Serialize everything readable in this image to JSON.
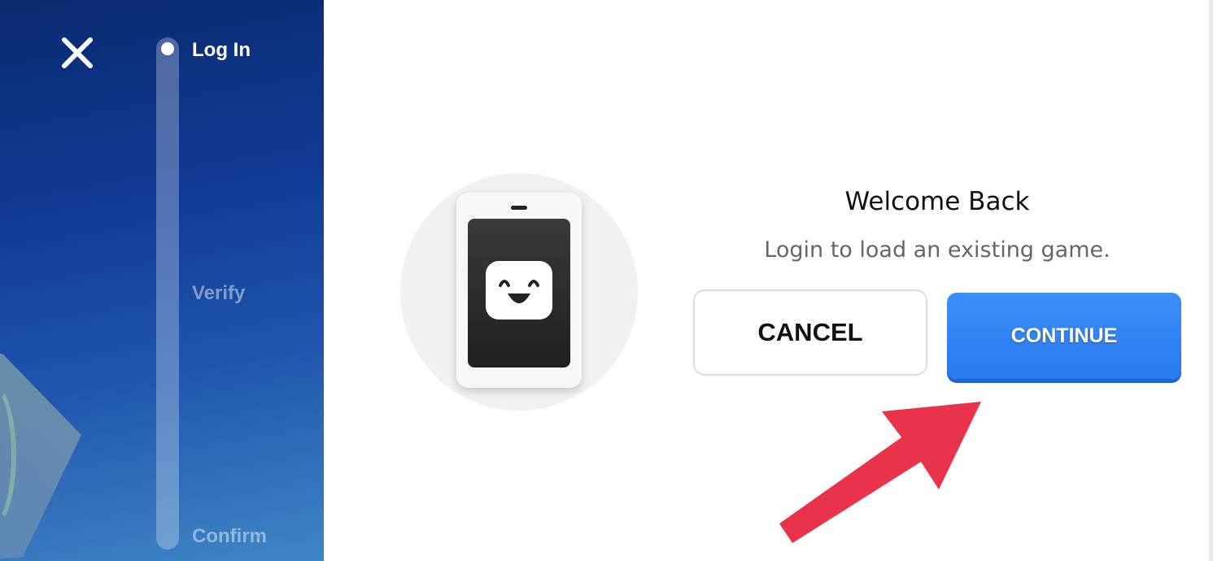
{
  "steps": {
    "active": "Log In",
    "second": "Verify",
    "third": "Confirm"
  },
  "dialog": {
    "title": "Welcome Back",
    "subtitle": "Login to load an existing game.",
    "cancel_label": "CANCEL",
    "continue_label": "CONTINUE"
  },
  "icons": {
    "close": "close-icon",
    "illustration": "smiling-phone-icon",
    "pointer": "arrow-icon"
  },
  "colors": {
    "panel": "#103a94",
    "primary": "#2a7af0",
    "arrow": "#e8334a"
  }
}
